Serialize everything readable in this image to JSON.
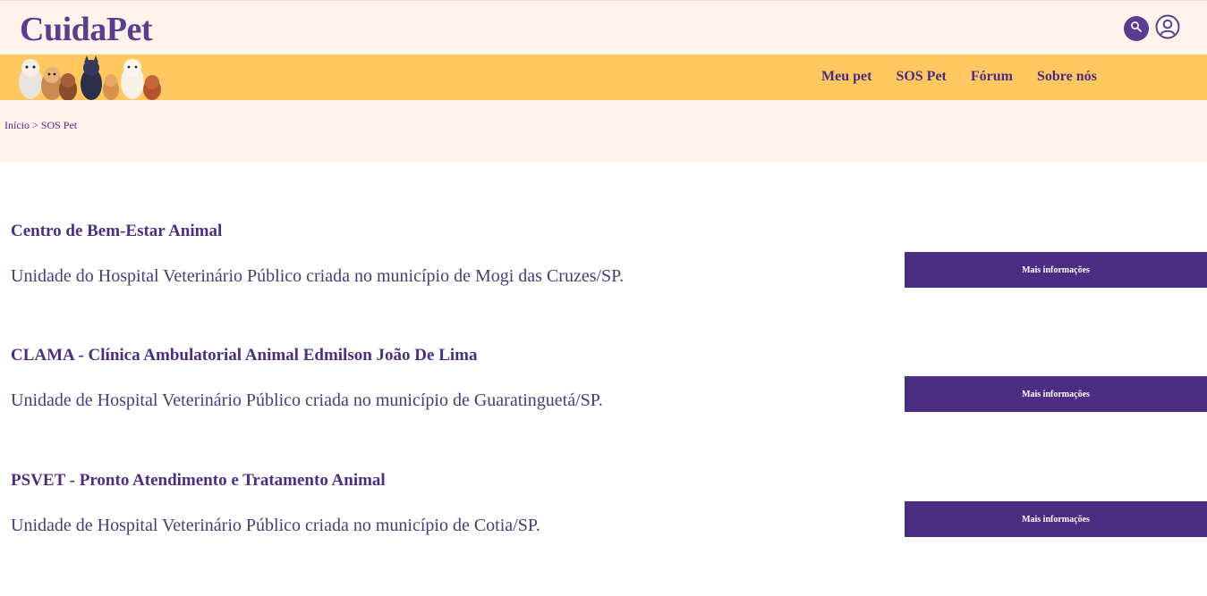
{
  "header": {
    "logo": "CuidaPet",
    "search_icon": "search-icon",
    "user_icon": "user-icon"
  },
  "nav": {
    "items": [
      {
        "label": "Meu pet"
      },
      {
        "label": "SOS Pet"
      },
      {
        "label": "Fórum"
      },
      {
        "label": "Sobre nós"
      }
    ]
  },
  "breadcrumb": {
    "home": "Início",
    "separator": " > ",
    "current": "SOS Pet"
  },
  "clinics": [
    {
      "title": "Centro de Bem-Estar Animal",
      "description": "Unidade do Hospital Veterinário Público criada no município de Mogi das Cruzes/SP.",
      "button": "Mais informações"
    },
    {
      "title": "CLAMA - Clínica Ambulatorial Animal Edmilson João De Lima",
      "description": "Unidade de Hospital Veterinário Público criada no município de Guaratinguetá/SP.",
      "button": "Mais informações"
    },
    {
      "title": "PSVET - Pronto Atendimento e Tratamento Animal",
      "description": "Unidade de Hospital Veterinário Público criada no município de Cotia/SP.",
      "button": "Mais informações"
    }
  ],
  "colors": {
    "primary": "#4b2e83",
    "accent_band": "#ffc75f",
    "light_background": "#fff3ec"
  }
}
